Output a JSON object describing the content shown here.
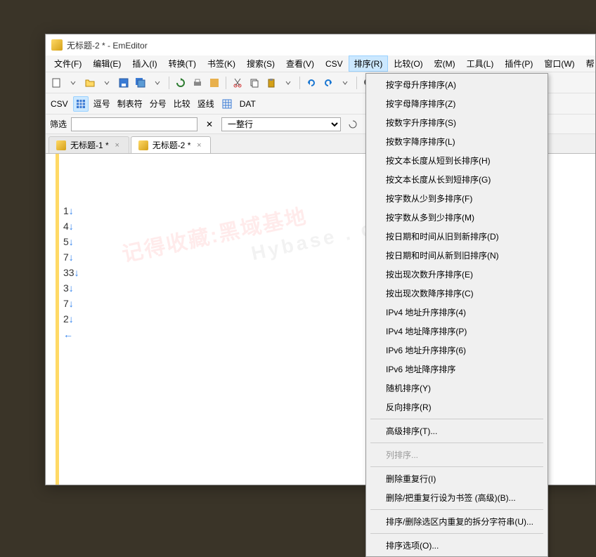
{
  "window": {
    "title": "无标题-2 * - EmEditor"
  },
  "menubar": {
    "items": [
      {
        "label": "文件(F)"
      },
      {
        "label": "编辑(E)"
      },
      {
        "label": "插入(I)"
      },
      {
        "label": "转换(T)"
      },
      {
        "label": "书签(K)"
      },
      {
        "label": "搜索(S)"
      },
      {
        "label": "查看(V)"
      },
      {
        "label": "CSV"
      },
      {
        "label": "排序(R)"
      },
      {
        "label": "比较(O)"
      },
      {
        "label": "宏(M)"
      },
      {
        "label": "工具(L)"
      },
      {
        "label": "插件(P)"
      },
      {
        "label": "窗口(W)"
      },
      {
        "label": "帮"
      }
    ],
    "active_index": 8
  },
  "toolbar2": {
    "csv": "CSV",
    "comma": "逗号",
    "tab": "制表符",
    "semi": "分号",
    "compare": "比较",
    "vline": "竖线",
    "dat": "DAT"
  },
  "filterbar": {
    "label": "筛选",
    "scope_value": "一整行"
  },
  "tabs": [
    {
      "label": "无标题-1 *",
      "active": false
    },
    {
      "label": "无标题-2 *",
      "active": true
    }
  ],
  "editor": {
    "lines": [
      "1",
      "4",
      "5",
      "7",
      "33",
      "3",
      "7",
      "2"
    ],
    "arrow": "↓",
    "eof": "←"
  },
  "dropdown": {
    "groups": [
      [
        "按字母升序排序(A)",
        "按字母降序排序(Z)",
        "按数字升序排序(S)",
        "按数字降序排序(L)",
        "按文本长度从短到长排序(H)",
        "按文本长度从长到短排序(G)",
        "按字数从少到多排序(F)",
        "按字数从多到少排序(M)",
        "按日期和时间从旧到新排序(D)",
        "按日期和时间从新到旧排序(N)",
        "按出现次数升序排序(E)",
        "按出现次数降序排序(C)",
        "IPv4 地址升序排序(4)",
        "IPv4 地址降序排序(P)",
        "IPv6 地址升序排序(6)",
        "IPv6 地址降序排序",
        "随机排序(Y)",
        "反向排序(R)"
      ],
      [
        "高级排序(T)..."
      ],
      [
        "__DISABLED__列排序..."
      ],
      [
        "删除重复行(I)",
        "删除/把重复行设为书签 (高级)(B)..."
      ],
      [
        "排序/删除选区内重复的拆分字符串(U)..."
      ],
      [
        "排序选项(O)..."
      ]
    ]
  },
  "watermark": {
    "cn": "记得收藏:黑域基地",
    "en": "Hybase . co"
  }
}
